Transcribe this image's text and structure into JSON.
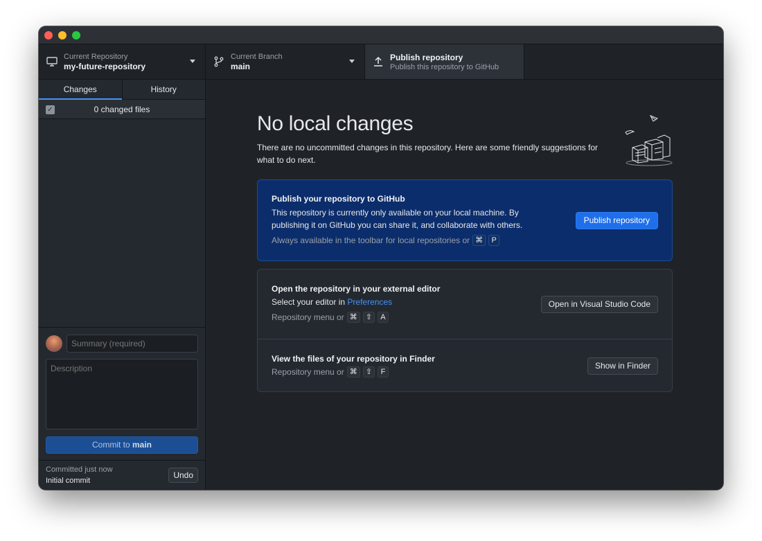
{
  "toolbar": {
    "repo": {
      "label": "Current Repository",
      "value": "my-future-repository",
      "icon": "desktop-icon"
    },
    "branch": {
      "label": "Current Branch",
      "value": "main",
      "icon": "branch-icon"
    },
    "publish": {
      "label": "Publish repository",
      "sub": "Publish this repository to GitHub",
      "icon": "upload-icon"
    }
  },
  "sidebar": {
    "tabs": [
      {
        "label": "Changes",
        "active": true
      },
      {
        "label": "History",
        "active": false
      }
    ],
    "changes_count": "0 changed files",
    "commit": {
      "summary_placeholder": "Summary (required)",
      "description_placeholder": "Description",
      "button_prefix": "Commit to ",
      "button_branch": "main"
    },
    "last_commit": {
      "label": "Committed just now",
      "message": "Initial commit",
      "undo_label": "Undo"
    }
  },
  "main": {
    "heading": "No local changes",
    "subtext": "There are no uncommitted changes in this repository. Here are some friendly suggestions for what to do next.",
    "publish_card": {
      "title": "Publish your repository to GitHub",
      "desc": "This repository is currently only available on your local machine. By publishing it on GitHub you can share it, and collaborate with others.",
      "hint": "Always available in the toolbar for local repositories or",
      "keys": [
        "⌘",
        "P"
      ],
      "button": "Publish repository"
    },
    "editor_card": {
      "title": "Open the repository in your external editor",
      "desc_prefix": "Select your editor in ",
      "desc_link": "Preferences",
      "hint": "Repository menu or",
      "keys": [
        "⌘",
        "⇧",
        "A"
      ],
      "button": "Open in Visual Studio Code"
    },
    "finder_card": {
      "title": "View the files of your repository in Finder",
      "hint": "Repository menu or",
      "keys": [
        "⌘",
        "⇧",
        "F"
      ],
      "button": "Show in Finder"
    }
  },
  "colors": {
    "accent": "#1f6feb",
    "link": "#4493f8",
    "publish_card_bg": "#0c2d6b"
  }
}
